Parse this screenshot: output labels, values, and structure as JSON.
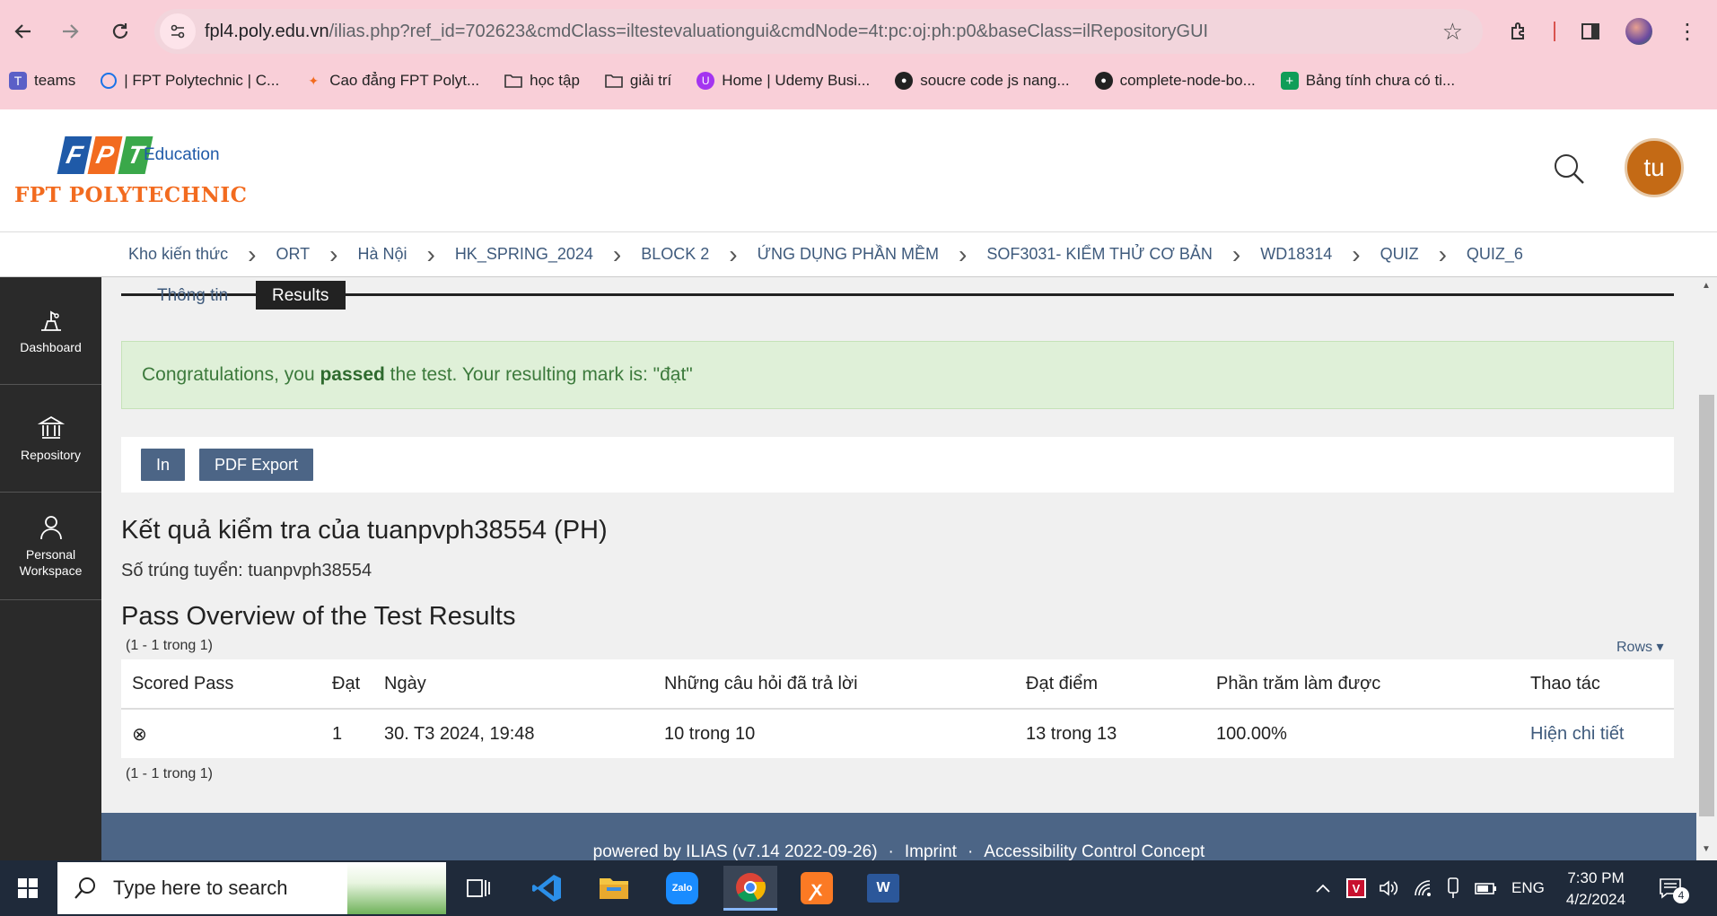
{
  "browser": {
    "url_host": "fpl4.poly.edu.vn",
    "url_path": "/ilias.php?ref_id=702623&cmdClass=iltestevaluationgui&cmdNode=4t:pc:oj:ph:p0&baseClass=ilRepositoryGUI",
    "bookmarks": [
      {
        "label": "teams",
        "icon": "teams-icon"
      },
      {
        "label": "| FPT Polytechnic | C...",
        "icon": "circle-icon"
      },
      {
        "label": "Cao đẳng FPT Polyt...",
        "icon": "fpt-icon"
      },
      {
        "label": "học tập",
        "icon": "folder-icon"
      },
      {
        "label": "giải trí",
        "icon": "folder-icon"
      },
      {
        "label": "Home | Udemy Busi...",
        "icon": "udemy-icon"
      },
      {
        "label": "soucre code js nang...",
        "icon": "github-icon"
      },
      {
        "label": "complete-node-bo...",
        "icon": "github-icon"
      },
      {
        "label": "Bảng tính chưa có ti...",
        "icon": "sheets-icon"
      }
    ]
  },
  "header": {
    "logo_fpt": [
      "F",
      "P",
      "T"
    ],
    "logo_education": "Education",
    "logo_polytechnic": "FPT POLYTECHNIC",
    "avatar_initials": "tu"
  },
  "breadcrumb": [
    "Kho kiến thức",
    "ORT",
    "Hà Nội",
    "HK_SPRING_2024",
    "BLOCK 2",
    "ỨNG DỤNG PHẦN MỀM",
    "SOF3031- KIỂM THỬ CƠ BẢN",
    "WD18314",
    "QUIZ",
    "QUIZ_6"
  ],
  "sidebar": {
    "items": [
      {
        "label": "Dashboard",
        "icon": "dashboard-icon"
      },
      {
        "label": "Repository",
        "icon": "repository-icon"
      },
      {
        "label": "Personal Workspace",
        "icon": "person-icon"
      }
    ]
  },
  "tabs": {
    "info": "Thông tin",
    "results": "Results"
  },
  "alert": {
    "prefix": "Congratulations, you ",
    "bold": "passed",
    "suffix": " the test. Your resulting mark is: \"đạt\""
  },
  "actions": {
    "print_label": "In",
    "pdf_label": "PDF Export"
  },
  "results": {
    "title": "Kết quả kiểm tra của tuanpvph38554 (PH)",
    "subtitle": "Số trúng tuyển: tuanpvph38554",
    "overview_title": "Pass Overview of the Test Results",
    "count_top": "(1 - 1 trong 1)",
    "count_bottom": "(1 - 1 trong 1)",
    "rows_label": "Rows ▾",
    "columns": [
      "Scored Pass",
      "Đạt",
      "Ngày",
      "Những câu hỏi đã trả lời",
      "Đạt điểm",
      "Phần trăm làm được",
      "Thao tác"
    ],
    "row": {
      "scored_pass": "⊗",
      "dat": "1",
      "ngay": "30. T3 2024, 19:48",
      "answered": "10 trong 10",
      "score": "13 trong 13",
      "percent": "100.00%",
      "action": "Hiện chi tiết"
    }
  },
  "footer": {
    "powered": "powered by ILIAS (v7.14 2022-09-26)",
    "dot": "·",
    "imprint": "Imprint",
    "accessibility": "Accessibility Control Concept"
  },
  "taskbar": {
    "search_placeholder": "Type here to search",
    "language": "ENG",
    "time": "7:30 PM",
    "date": "4/2/2024",
    "notifications": "4"
  }
}
